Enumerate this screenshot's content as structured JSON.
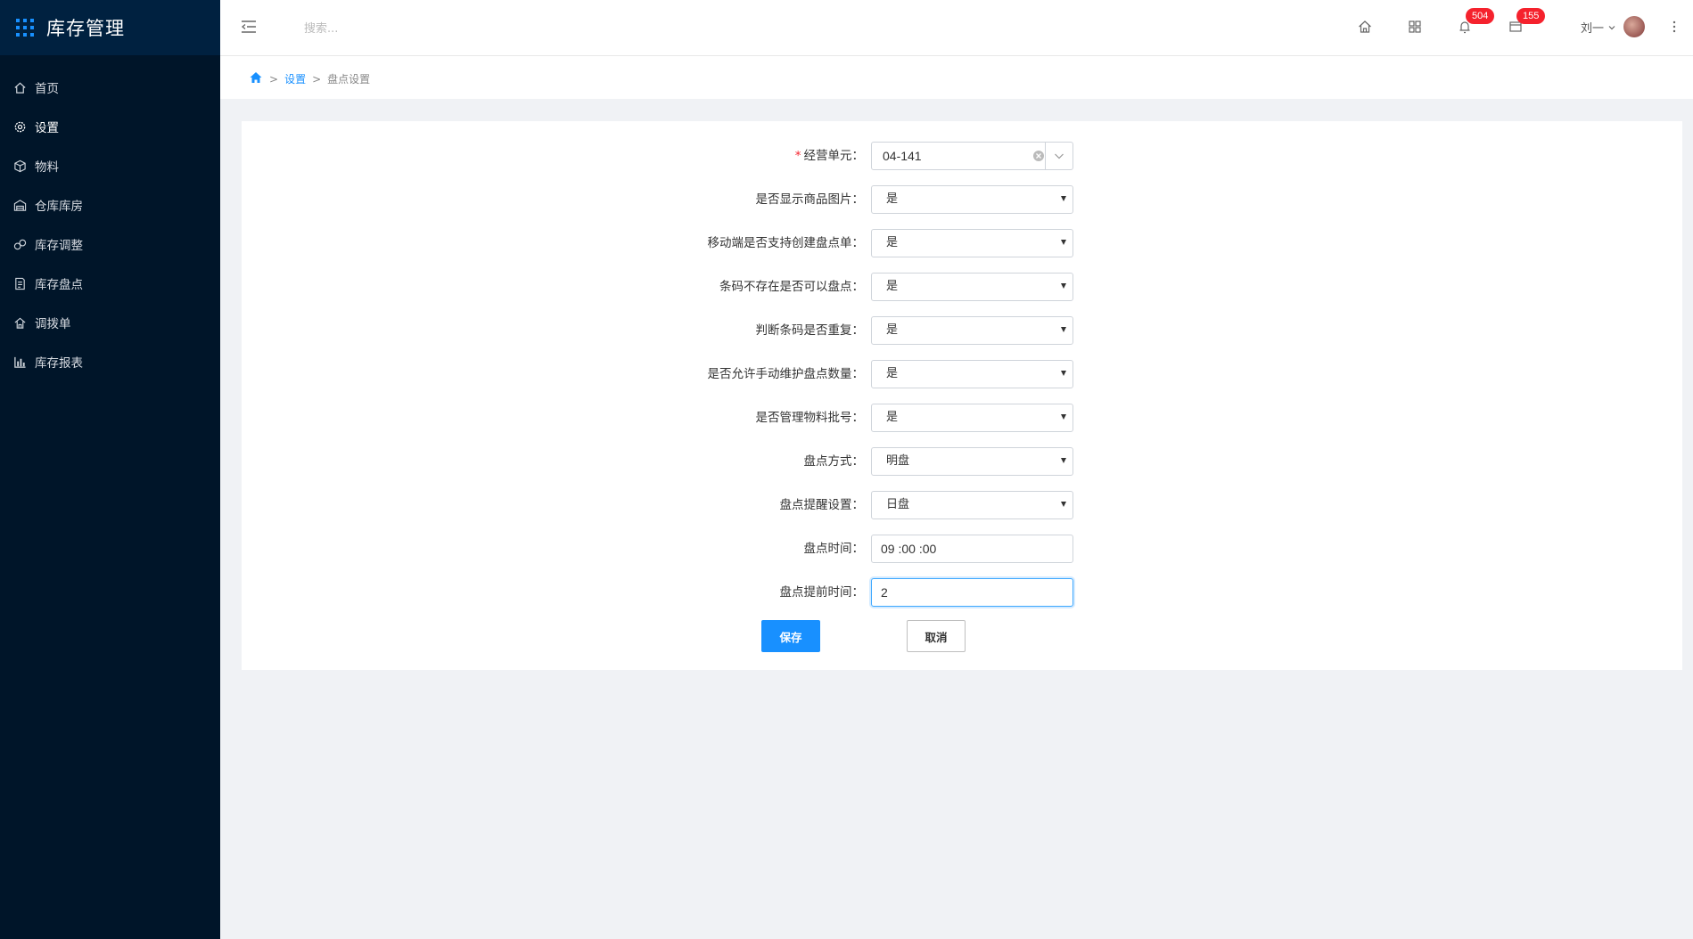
{
  "app": {
    "title": "库存管理"
  },
  "sidebar": {
    "items": [
      {
        "label": "首页",
        "icon": "home-icon"
      },
      {
        "label": "设置",
        "icon": "gear-icon",
        "active": true
      },
      {
        "label": "物料",
        "icon": "cube-icon"
      },
      {
        "label": "仓库库房",
        "icon": "warehouse-icon"
      },
      {
        "label": "库存调整",
        "icon": "adjust-icon"
      },
      {
        "label": "库存盘点",
        "icon": "checklist-icon"
      },
      {
        "label": "调拨单",
        "icon": "transfer-icon"
      },
      {
        "label": "库存报表",
        "icon": "bar-chart-icon"
      }
    ]
  },
  "header": {
    "search_placeholder": "搜索...",
    "notifications_count": "504",
    "messages_count": "155",
    "user_name": "刘一"
  },
  "breadcrumb": {
    "items": [
      "设置",
      "盘点设置"
    ]
  },
  "form": {
    "business_unit": {
      "label": "经营单元：",
      "value": "04-141"
    },
    "show_image": {
      "label": "是否显示商品图片：",
      "value": "是"
    },
    "mobile_create": {
      "label": "移动端是否支持创建盘点单：",
      "value": "是"
    },
    "barcode_missing": {
      "label": "条码不存在是否可以盘点：",
      "value": "是"
    },
    "barcode_duplicate": {
      "label": "判断条码是否重复：",
      "value": "是"
    },
    "manual_quantity": {
      "label": "是否允许手动维护盘点数量：",
      "value": "是"
    },
    "batch_manage": {
      "label": "是否管理物料批号：",
      "value": "是"
    },
    "count_method": {
      "label": "盘点方式：",
      "value": "明盘"
    },
    "reminder_setting": {
      "label": "盘点提醒设置：",
      "value": "日盘"
    },
    "count_time": {
      "label": "盘点时间：",
      "value": "09 :00 :00"
    },
    "advance_time": {
      "label": "盘点提前时间：",
      "value": "2"
    },
    "save_label": "保存",
    "cancel_label": "取消"
  },
  "colors": {
    "sidebar_bg": "#001529",
    "accent": "#1890ff",
    "badge": "#f5222d"
  }
}
